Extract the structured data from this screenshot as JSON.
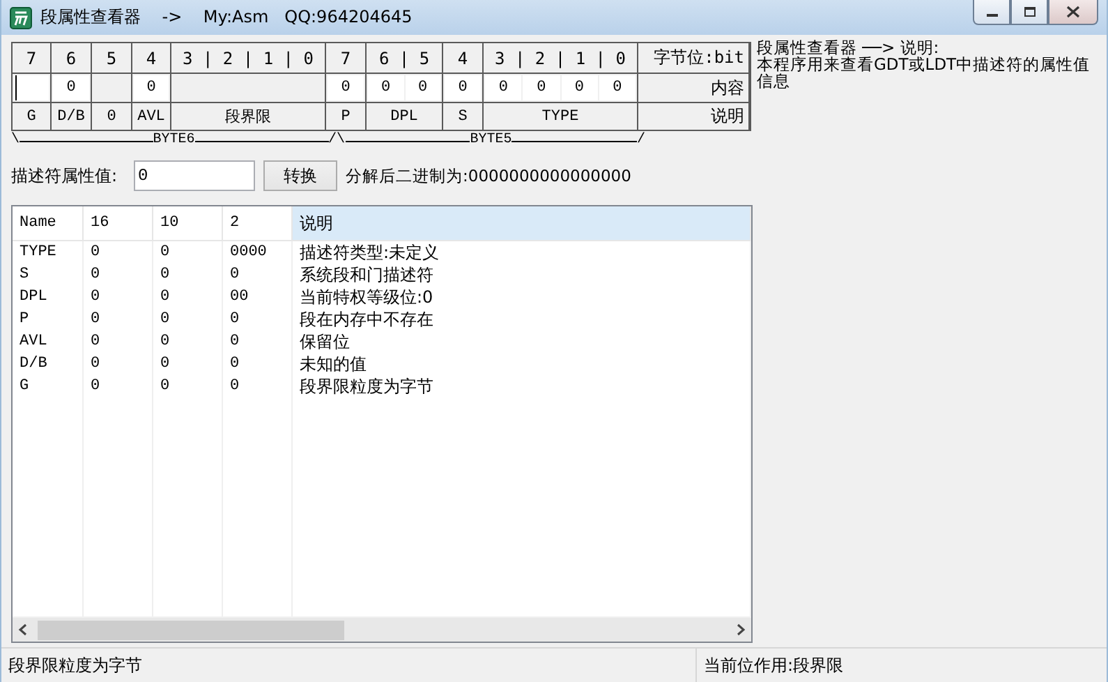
{
  "window": {
    "title": "段属性查看器    ->    My:Asm   QQ:964204645"
  },
  "bit_table": {
    "columns": [
      {
        "bits": "7",
        "fields": [
          {
            "focused": true
          }
        ],
        "label": "G"
      },
      {
        "bits": "6",
        "fields": [
          {
            "value": "0",
            "focused": false
          }
        ],
        "label": "D/B"
      },
      {
        "bits": "5",
        "label": "0"
      },
      {
        "bits": "4",
        "fields": [
          {
            "value": "0",
            "focused": false
          }
        ],
        "label": "AVL"
      },
      {
        "bits": "3 | 2 | 1 | 0",
        "label": "段界限"
      },
      {
        "bits": "7",
        "fields": [
          {
            "value": "0",
            "focused": false
          }
        ],
        "label": "P"
      },
      {
        "bits": "6 | 5",
        "fields": [
          {
            "value": "0",
            "focused": false
          },
          {
            "value": "0",
            "focused": false
          }
        ],
        "label": "DPL"
      },
      {
        "bits": "4",
        "fields": [
          {
            "value": "0",
            "focused": false
          }
        ],
        "label": "S"
      },
      {
        "bits": "3 | 2 | 1 | 0",
        "fields": [
          {
            "value": "0",
            "focused": false
          },
          {
            "value": "0",
            "focused": false
          },
          {
            "value": "0",
            "focused": false
          },
          {
            "value": "0",
            "focused": false
          }
        ],
        "label": "TYPE"
      }
    ],
    "legend": {
      "bits": "字节位:bit",
      "content": "内容",
      "label": "说明"
    }
  },
  "byte_ruler": [
    {
      "start": "\\",
      "label": "BYTE6"
    },
    {
      "start": "/\\",
      "label": "BYTE5",
      "end": "/"
    }
  ],
  "attribute": {
    "label": "描述符属性值:",
    "value": "0",
    "button": "转换",
    "result": "分解后二进制为:0000000000000000"
  },
  "info": {
    "title": "段属性查看器 ──> 说明:",
    "text": "本程序用来查看GDT或LDT中描述符的属性值信息"
  },
  "list": {
    "columns": [
      {
        "label": "Name",
        "highlighted": false
      },
      {
        "label": "16",
        "highlighted": false
      },
      {
        "label": "10",
        "highlighted": false
      },
      {
        "label": "2",
        "highlighted": false
      },
      {
        "label": "说明",
        "highlighted": true
      }
    ],
    "rows": [
      [
        "TYPE",
        "0",
        "0",
        "0000",
        "描述符类型:未定义"
      ],
      [
        "S",
        "0",
        "0",
        "0",
        "系统段和门描述符"
      ],
      [
        "DPL",
        "0",
        "0",
        "00",
        "当前特权等级位:0"
      ],
      [
        "P",
        "0",
        "0",
        "0",
        "段在内存中不存在"
      ],
      [
        "AVL",
        "0",
        "0",
        "0",
        "保留位"
      ],
      [
        "D/B",
        "0",
        "0",
        "0",
        "未知的值"
      ],
      [
        "G",
        "0",
        "0",
        "0",
        "段界限粒度为字节"
      ]
    ]
  },
  "status_bar": [
    "段界限粒度为字节",
    "当前位作用:段界限"
  ]
}
